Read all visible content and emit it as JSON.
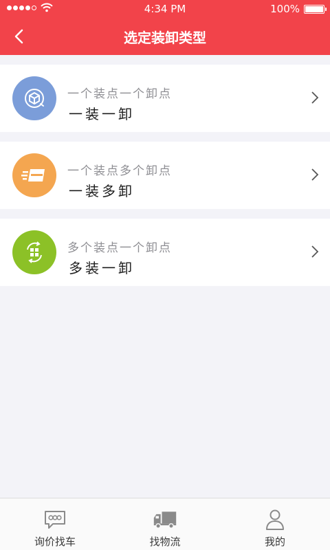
{
  "status_bar": {
    "time": "4:34 PM",
    "battery": "100%",
    "battery_level": 1.0
  },
  "header": {
    "title": "选定装卸类型",
    "background": "#f2434a"
  },
  "options": [
    {
      "subtitle": "一个装点一个卸点",
      "title": "一装一卸",
      "icon": "box-icon",
      "color": "#7b9dd9"
    },
    {
      "subtitle": "一个装点多个卸点",
      "title": "一装多卸",
      "icon": "fast-delivery-icon",
      "color": "#f4a650"
    },
    {
      "subtitle": "多个装点一个卸点",
      "title": "多装一卸",
      "icon": "exchange-box-icon",
      "color": "#8cc127"
    }
  ],
  "tabs": [
    {
      "label": "询价找车",
      "icon": "chat-bubble-icon"
    },
    {
      "label": "找物流",
      "icon": "truck-icon"
    },
    {
      "label": "我的",
      "icon": "user-icon"
    }
  ]
}
